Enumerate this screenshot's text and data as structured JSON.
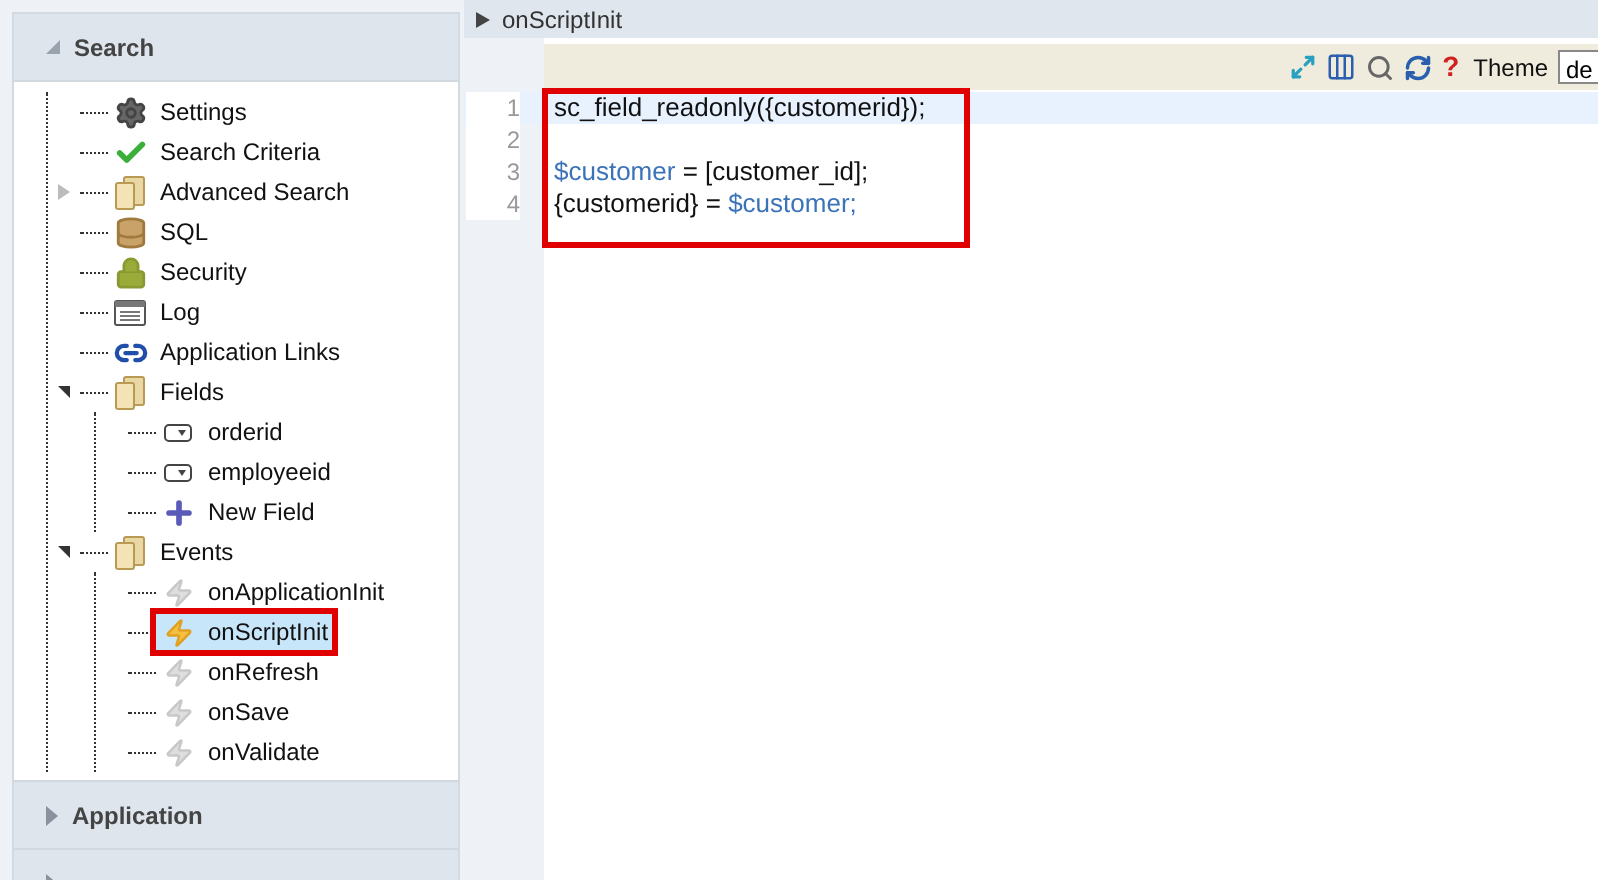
{
  "sidebar": {
    "sections": [
      {
        "title": "Search",
        "expanded": true,
        "tree": [
          {
            "label": "Settings",
            "kind": "gear",
            "selected": false
          },
          {
            "label": "Search Criteria",
            "kind": "check",
            "selected": false
          },
          {
            "label": "Advanced Search",
            "kind": "folder",
            "selected": false,
            "expanded": false
          },
          {
            "label": "SQL",
            "kind": "database",
            "selected": false
          },
          {
            "label": "Security",
            "kind": "lock",
            "selected": false
          },
          {
            "label": "Log",
            "kind": "log",
            "selected": false
          },
          {
            "label": "Application Links",
            "kind": "link",
            "selected": false
          },
          {
            "label": "Fields",
            "kind": "folder",
            "selected": false,
            "expanded": true,
            "children": [
              {
                "label": "orderid",
                "kind": "field",
                "selected": false
              },
              {
                "label": "employeeid",
                "kind": "field",
                "selected": false
              },
              {
                "label": "New Field",
                "kind": "plus",
                "selected": false
              }
            ]
          },
          {
            "label": "Events",
            "kind": "folder",
            "selected": false,
            "expanded": true,
            "children": [
              {
                "label": "onApplicationInit",
                "kind": "event",
                "selected": false
              },
              {
                "label": "onScriptInit",
                "kind": "event",
                "selected": true
              },
              {
                "label": "onRefresh",
                "kind": "event",
                "selected": false
              },
              {
                "label": "onSave",
                "kind": "event",
                "selected": false
              },
              {
                "label": "onValidate",
                "kind": "event",
                "selected": false
              }
            ]
          }
        ]
      },
      {
        "title": "Application",
        "expanded": false
      },
      {
        "expanded": false
      }
    ]
  },
  "editor": {
    "title": "onScriptInit",
    "toolbar": {
      "help": "?",
      "theme_label": "Theme",
      "theme_value": "de"
    },
    "lines": [
      {
        "number": "1",
        "highlighted": true,
        "tokens": [
          {
            "kind": "plain",
            "text": "sc_field_readonly({customerid});"
          }
        ]
      },
      {
        "number": "2",
        "highlighted": false
      },
      {
        "number": "3",
        "highlighted": false,
        "tokens": [
          {
            "kind": "var",
            "text": "$customer"
          },
          {
            "kind": "plain",
            "text": " = [customer_id];"
          }
        ]
      },
      {
        "number": "4",
        "highlighted": false,
        "tokens": [
          {
            "kind": "plain",
            "text": "{customerid} = "
          },
          {
            "kind": "var",
            "text": "$customer;"
          }
        ]
      }
    ]
  }
}
